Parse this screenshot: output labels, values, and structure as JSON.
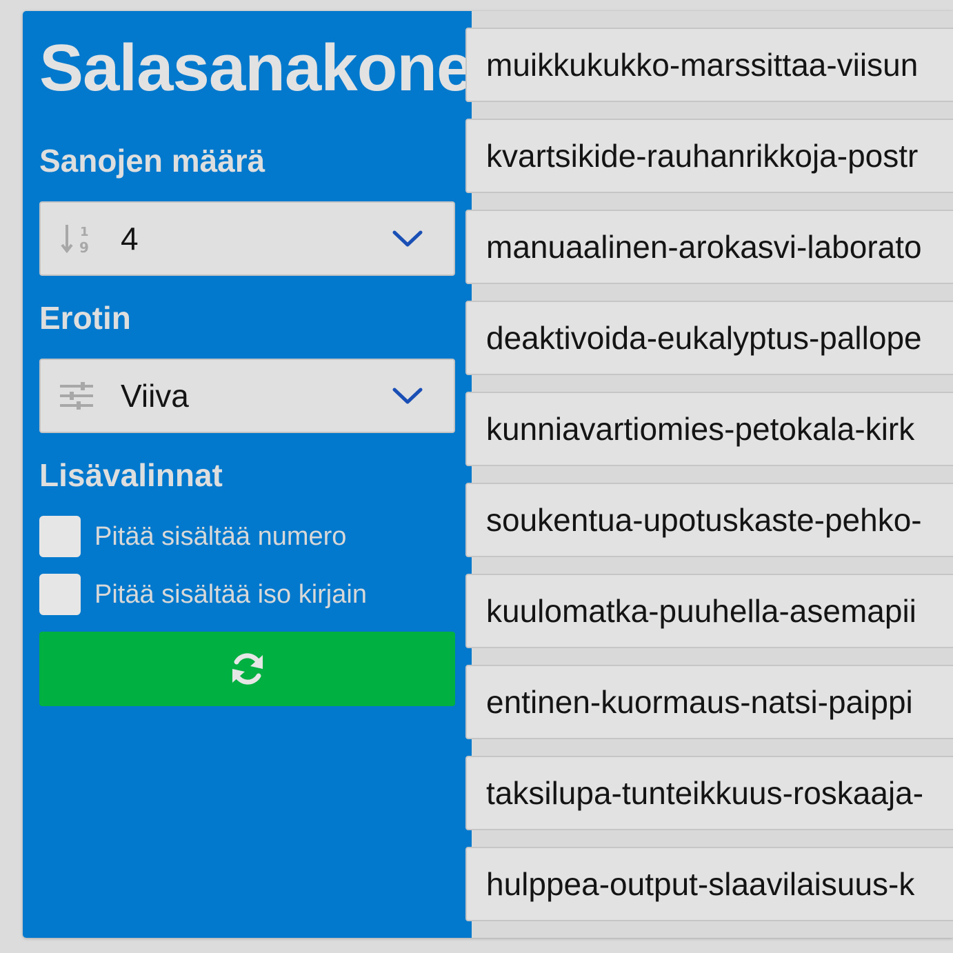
{
  "app": {
    "title": "Salasanakone"
  },
  "word_count": {
    "label": "Sanojen määrä",
    "icon": "sort-numeric-icon",
    "selected": "4"
  },
  "separator": {
    "label": "Erotin",
    "icon": "sliders-icon",
    "selected": "Viiva"
  },
  "options": {
    "label": "Lisävalinnat",
    "items": [
      {
        "label": "Pitää sisältää numero",
        "checked": false
      },
      {
        "label": "Pitää sisältää iso kirjain",
        "checked": false
      }
    ]
  },
  "generate_button": {
    "icon": "refresh-icon"
  },
  "passwords": [
    "muikkukukko-marssittaa-viisun",
    "kvartsikide-rauhanrikkoja-postr",
    "manuaalinen-arokasvi-laborato",
    "deaktivoida-eukalyptus-pallope",
    "kunniavartiomies-petokala-kirk",
    "soukentua-upotuskaste-pehko-",
    "kuulomatka-puuhella-asemapii",
    "entinen-kuormaus-natsi-paippi",
    "taksilupa-tunteikkuus-roskaaja-",
    "hulppea-output-slaavilaisuus-k"
  ],
  "colors": {
    "sidebar": "#0279cc",
    "accent_green": "#00b040",
    "chevron_blue": "#1a4fb5"
  }
}
